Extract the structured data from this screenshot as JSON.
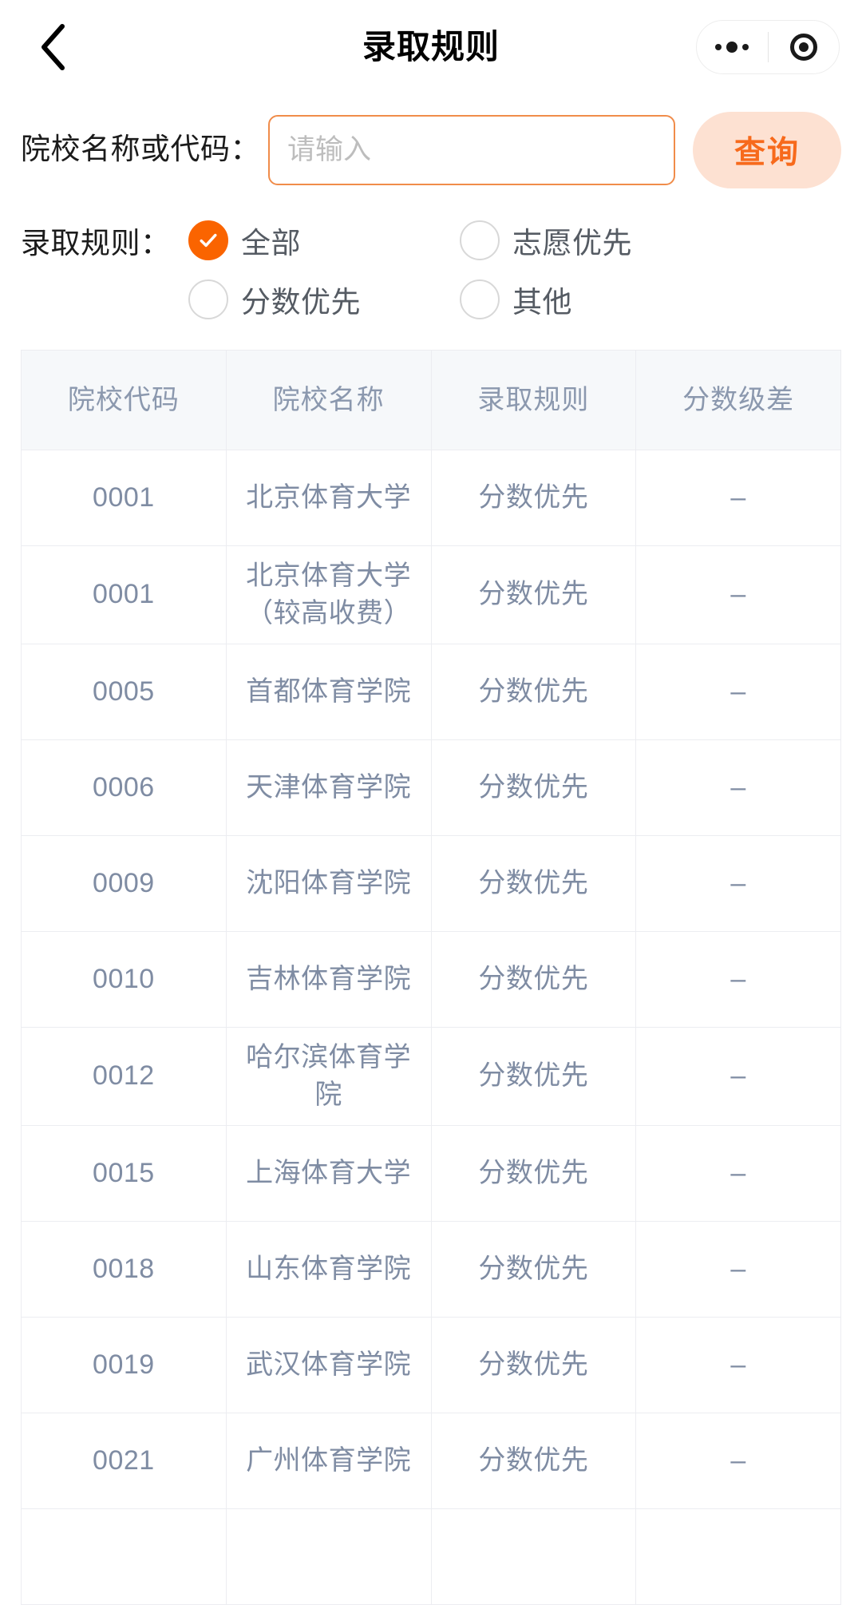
{
  "theme": {
    "accent": "#fa6400",
    "accent_soft_bg": "#fde1d2",
    "accent_border": "#f08c4a",
    "table_header_bg": "#f6f8fa",
    "table_text": "#7f8ca3",
    "table_border": "#ecedf1"
  },
  "navbar": {
    "title": "录取规则",
    "back_icon": "chevron-left-icon",
    "more_icon": "more-dots-icon",
    "target_icon": "target-circle-icon"
  },
  "search": {
    "label": "院校名称或代码：",
    "placeholder": "请输入",
    "value": "",
    "button_label": "查询"
  },
  "filter": {
    "label": "录取规则：",
    "options": [
      {
        "label": "全部",
        "checked": true
      },
      {
        "label": "志愿优先",
        "checked": false
      },
      {
        "label": "分数优先",
        "checked": false
      },
      {
        "label": "其他",
        "checked": false
      }
    ]
  },
  "table": {
    "columns": [
      "院校代码",
      "院校名称",
      "录取规则",
      "分数级差"
    ],
    "rows": [
      {
        "code": "0001",
        "name": "北京体育大学",
        "rule": "分数优先",
        "diff": "–"
      },
      {
        "code": "0001",
        "name": "北京体育大学（较高收费）",
        "rule": "分数优先",
        "diff": "–"
      },
      {
        "code": "0005",
        "name": "首都体育学院",
        "rule": "分数优先",
        "diff": "–"
      },
      {
        "code": "0006",
        "name": "天津体育学院",
        "rule": "分数优先",
        "diff": "–"
      },
      {
        "code": "0009",
        "name": "沈阳体育学院",
        "rule": "分数优先",
        "diff": "–"
      },
      {
        "code": "0010",
        "name": "吉林体育学院",
        "rule": "分数优先",
        "diff": "–"
      },
      {
        "code": "0012",
        "name": "哈尔滨体育学院",
        "rule": "分数优先",
        "diff": "–"
      },
      {
        "code": "0015",
        "name": "上海体育大学",
        "rule": "分数优先",
        "diff": "–"
      },
      {
        "code": "0018",
        "name": "山东体育学院",
        "rule": "分数优先",
        "diff": "–"
      },
      {
        "code": "0019",
        "name": "武汉体育学院",
        "rule": "分数优先",
        "diff": "–"
      },
      {
        "code": "0021",
        "name": "广州体育学院",
        "rule": "分数优先",
        "diff": "–"
      },
      {
        "code": "",
        "name": "",
        "rule": "",
        "diff": ""
      }
    ]
  }
}
